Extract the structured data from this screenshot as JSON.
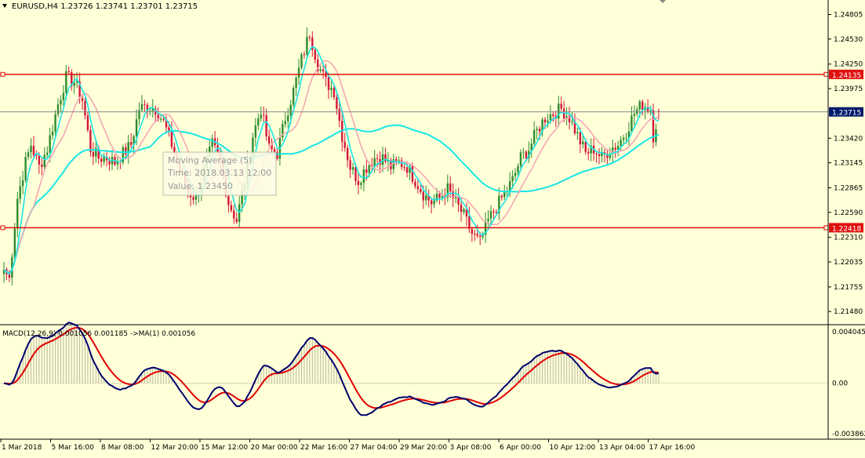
{
  "colors": {
    "background": "#ffffd8",
    "axis_text": "#000000",
    "candle_bull": "#2e8b2e",
    "candle_bear": "#d4163c",
    "ma_fast": "#19e6e6",
    "ma_slow": "#f4a7b4",
    "hline": "#e01010",
    "hline_label_bg": "#e01010",
    "price_label_bg": "#001a6a",
    "macd_main": "#00006e",
    "macd_signal": "#e00000",
    "macd_hist": "#b8b8a0"
  },
  "header": {
    "title": "EURUSD,H4  1.23726 1.23741 1.23701 1.23715",
    "menu_icon": "triangle-down-icon"
  },
  "tooltip": {
    "title": "Moving Average (5)",
    "time": "Time: 2018.03.13 12:00",
    "value": "Value: 1.23450"
  },
  "chart_data": [
    {
      "type": "candlestick",
      "symbol": "EURUSD",
      "timeframe": "H4",
      "ohlc_last": {
        "open": 1.23726,
        "high": 1.23741,
        "low": 1.23701,
        "close": 1.23715
      },
      "ylim": [
        1.2135,
        1.2495
      ],
      "price_axis_ticks": [
        "1.24805",
        "1.24530",
        "1.24250",
        "1.23975",
        "1.23420",
        "1.23145",
        "1.22865",
        "1.22590",
        "1.22310",
        "1.22035",
        "1.21755",
        "1.21480"
      ],
      "time_axis_ticks": [
        "1 Mar 2018",
        "5 Mar 16:00",
        "8 Mar 08:00",
        "12 Mar 20:00",
        "15 Mar 12:00",
        "20 Mar 00:00",
        "22 Mar 16:00",
        "27 Mar 04:00",
        "29 Mar 20:00",
        "3 Apr 08:00",
        "6 Apr 00:00",
        "10 Apr 12:00",
        "13 Apr 04:00",
        "17 Apr 16:00"
      ],
      "horizontal_lines": [
        {
          "label": "1.24135",
          "value": 1.24135
        },
        {
          "label": "1.22418",
          "value": 1.22418
        }
      ],
      "current_price": {
        "label": "1.23715",
        "value": 1.23715
      },
      "anchors": [
        [
          0,
          1.2195
        ],
        [
          2,
          1.2185
        ],
        [
          5,
          1.2275
        ],
        [
          8,
          1.2315
        ],
        [
          10,
          1.2335
        ],
        [
          13,
          1.231
        ],
        [
          16,
          1.233
        ],
        [
          20,
          1.238
        ],
        [
          23,
          1.241
        ],
        [
          26,
          1.2405
        ],
        [
          29,
          1.2385
        ],
        [
          32,
          1.233
        ],
        [
          35,
          1.232
        ],
        [
          38,
          1.232
        ],
        [
          41,
          1.2315
        ],
        [
          44,
          1.2325
        ],
        [
          47,
          1.2335
        ],
        [
          50,
          1.2375
        ],
        [
          53,
          1.2378
        ],
        [
          56,
          1.2375
        ],
        [
          59,
          1.236
        ],
        [
          62,
          1.2335
        ],
        [
          65,
          1.2305
        ],
        [
          68,
          1.2282
        ],
        [
          71,
          1.2275
        ],
        [
          74,
          1.2305
        ],
        [
          77,
          1.2335
        ],
        [
          80,
          1.2315
        ],
        [
          83,
          1.227
        ],
        [
          86,
          1.225
        ],
        [
          89,
          1.2295
        ],
        [
          92,
          1.2345
        ],
        [
          95,
          1.2375
        ],
        [
          98,
          1.233
        ],
        [
          101,
          1.2325
        ],
        [
          104,
          1.2365
        ],
        [
          107,
          1.2395
        ],
        [
          110,
          1.243
        ],
        [
          113,
          1.246
        ],
        [
          116,
          1.2425
        ],
        [
          119,
          1.2405
        ],
        [
          122,
          1.2395
        ],
        [
          125,
          1.2345
        ],
        [
          128,
          1.231
        ],
        [
          131,
          1.2295
        ],
        [
          134,
          1.231
        ],
        [
          137,
          1.232
        ],
        [
          140,
          1.232
        ],
        [
          143,
          1.231
        ],
        [
          146,
          1.2315
        ],
        [
          149,
          1.231
        ],
        [
          152,
          1.2295
        ],
        [
          155,
          1.228
        ],
        [
          158,
          1.227
        ],
        [
          161,
          1.2275
        ],
        [
          164,
          1.2285
        ],
        [
          167,
          1.227
        ],
        [
          170,
          1.2255
        ],
        [
          173,
          1.2235
        ],
        [
          176,
          1.2225
        ],
        [
          179,
          1.225
        ],
        [
          182,
          1.2265
        ],
        [
          185,
          1.228
        ],
        [
          188,
          1.2295
        ],
        [
          191,
          1.232
        ],
        [
          194,
          1.233
        ],
        [
          197,
          1.235
        ],
        [
          200,
          1.2365
        ],
        [
          203,
          1.237
        ],
        [
          206,
          1.2375
        ],
        [
          209,
          1.2365
        ],
        [
          212,
          1.2345
        ],
        [
          215,
          1.2325
        ],
        [
          218,
          1.233
        ],
        [
          221,
          1.232
        ],
        [
          224,
          1.233
        ],
        [
          227,
          1.2335
        ],
        [
          230,
          1.235
        ],
        [
          233,
          1.237
        ],
        [
          236,
          1.238
        ],
        [
          239,
          1.2375
        ],
        [
          240,
          1.2345
        ],
        [
          242,
          1.2371
        ]
      ],
      "series": [
        {
          "name": "Moving Average (5)",
          "color": "#19e6e6",
          "period": 5
        },
        {
          "color": "#f4a7b4",
          "period": 12
        },
        {
          "color": "#19e6e6",
          "period": 55
        }
      ]
    },
    {
      "type": "line",
      "indicator": "MACD",
      "label": "MACD(12,26,9) 0.001056 0.001185  ->MA(1) 0.001056",
      "ylim": [
        -0.004,
        0.0042
      ],
      "y_ticks": [
        "0.004045",
        "0.00",
        "-0.003862"
      ],
      "series": [
        {
          "type": "histogram",
          "color": "#b8b8a0"
        },
        {
          "type": "line",
          "color": "#00006e"
        },
        {
          "type": "line",
          "color": "#e00000"
        }
      ]
    }
  ]
}
